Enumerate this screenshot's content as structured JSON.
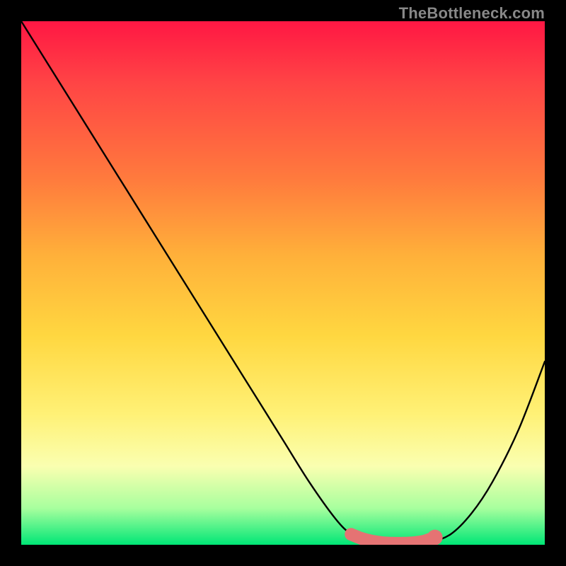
{
  "watermark": "TheBottleneck.com",
  "colors": {
    "background": "#000000",
    "curve": "#000000",
    "marker_fill": "#e57373",
    "marker_stroke": "#c94f4f"
  },
  "chart_data": {
    "type": "line",
    "title": "",
    "xlabel": "",
    "ylabel": "",
    "xlim": [
      0,
      100
    ],
    "ylim": [
      0,
      100
    ],
    "series": [
      {
        "name": "bottleneck-curve",
        "x": [
          0,
          5,
          10,
          15,
          20,
          25,
          30,
          35,
          40,
          45,
          50,
          55,
          60,
          63,
          66,
          70,
          74,
          78,
          82,
          86,
          90,
          95,
          100
        ],
        "values": [
          100,
          92,
          84,
          76,
          68,
          60,
          52,
          44,
          36,
          28,
          20,
          12,
          5,
          2,
          0.5,
          0,
          0,
          0.5,
          2,
          6,
          12,
          22,
          35
        ]
      },
      {
        "name": "optimal-marker",
        "x": [
          63,
          65,
          67,
          69,
          71,
          73,
          75,
          77,
          79
        ],
        "values": [
          2,
          1.2,
          0.7,
          0.4,
          0.3,
          0.3,
          0.4,
          0.7,
          1.4
        ]
      }
    ]
  }
}
